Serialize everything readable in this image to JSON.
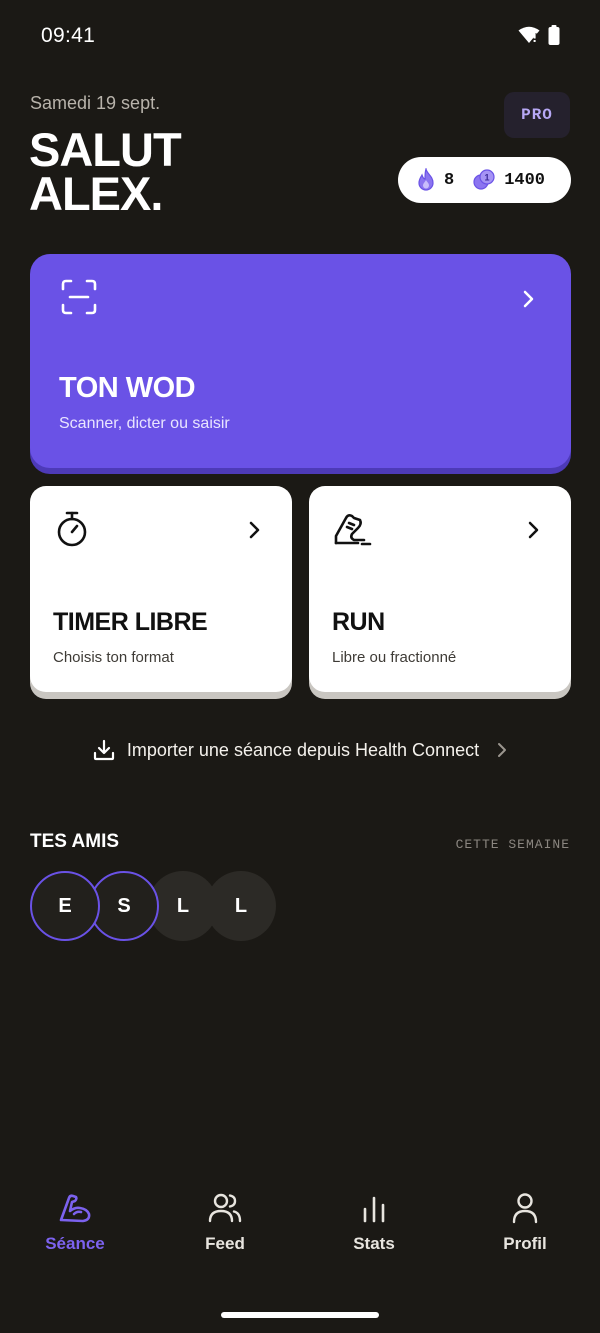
{
  "status_bar": {
    "time": "09:41"
  },
  "header": {
    "date": "Samedi 19 sept.",
    "greeting_line1": "SALUT",
    "greeting_line2": "ALEX.",
    "pro_label": "PRO",
    "streak_value": "8",
    "coins_value": "1400"
  },
  "wod_card": {
    "title": "TON WOD",
    "subtitle": "Scanner, dicter ou saisir",
    "color": "#6a52e6"
  },
  "cards": [
    {
      "title": "TIMER LIBRE",
      "subtitle": "Choisis ton format",
      "icon": "stopwatch-icon"
    },
    {
      "title": "RUN",
      "subtitle": "Libre ou fractionné",
      "icon": "running-shoe-icon"
    }
  ],
  "import": {
    "label": "Importer une séance depuis Health Connect"
  },
  "friends": {
    "title": "TES AMIS",
    "period": "CETTE SEMAINE",
    "avatars": [
      {
        "initial": "E",
        "active": true
      },
      {
        "initial": "S",
        "active": true
      },
      {
        "initial": "L",
        "active": false
      },
      {
        "initial": "L",
        "active": false
      }
    ]
  },
  "nav": {
    "items": [
      {
        "label": "Séance",
        "icon": "flexed-arm-icon",
        "active": true
      },
      {
        "label": "Feed",
        "icon": "users-icon",
        "active": false
      },
      {
        "label": "Stats",
        "icon": "bar-chart-icon",
        "active": false
      },
      {
        "label": "Profil",
        "icon": "user-icon",
        "active": false
      }
    ]
  },
  "colors": {
    "accent": "#6a52e6",
    "background": "#1b1915"
  }
}
